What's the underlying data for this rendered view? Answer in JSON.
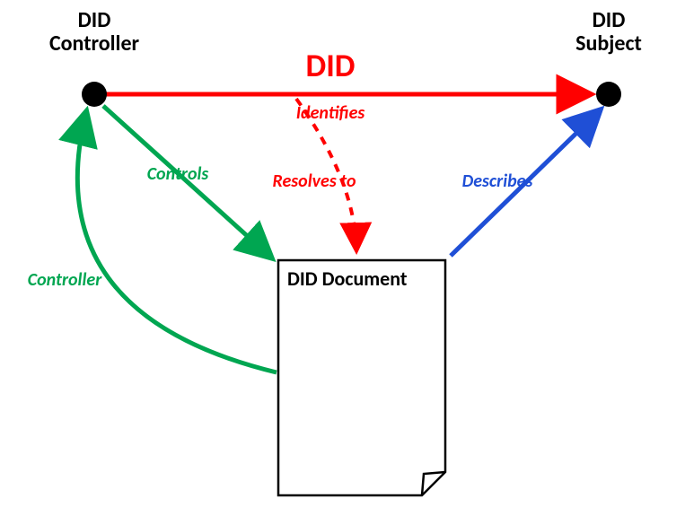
{
  "nodes": {
    "controller": {
      "title_line1": "DID",
      "title_line2": "Controller"
    },
    "subject": {
      "title_line1": "DID",
      "title_line2": "Subject"
    },
    "document": {
      "label": "DID Document"
    }
  },
  "edges": {
    "did_title": "DID",
    "identifies": "Identifies",
    "resolves_to": "Resolves to",
    "controls": "Controls",
    "controller": "Controller",
    "describes": "Describes"
  },
  "colors": {
    "red": "#ff0000",
    "green": "#00a651",
    "blue": "#1f4fd6",
    "black": "#000000"
  }
}
